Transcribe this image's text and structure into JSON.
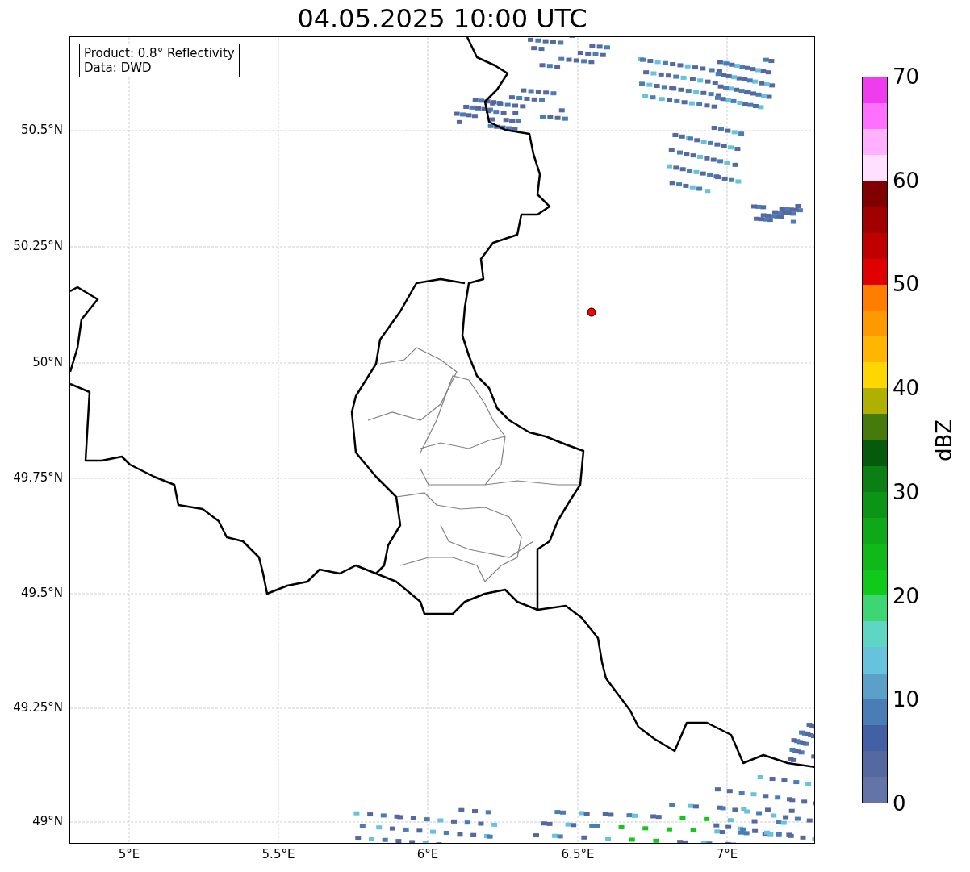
{
  "title": "04.05.2025 10:00 UTC",
  "map": {
    "legend": [
      "Product: 0.8° Reflectivity",
      "Data: DWD"
    ],
    "x_ticks": [
      "5°E",
      "5.5°E",
      "6°E",
      "6.5°E",
      "7°E"
    ],
    "y_ticks": [
      "50.5°N",
      "50.25°N",
      "50°N",
      "49.75°N",
      "49.5°N",
      "49.25°N",
      "49°N"
    ]
  },
  "colorbar": {
    "label": "dBZ",
    "ticks": [
      "70",
      "60",
      "50",
      "40",
      "30",
      "20",
      "10",
      "0"
    ],
    "bins": [
      {
        "color": "#ee3cee"
      },
      {
        "color": "#ff70ff"
      },
      {
        "color": "#ffb0ff"
      },
      {
        "color": "#ffe0ff"
      },
      {
        "color": "#800000"
      },
      {
        "color": "#a00000"
      },
      {
        "color": "#c00000"
      },
      {
        "color": "#e00000"
      },
      {
        "color": "#ff7e00"
      },
      {
        "color": "#ff9900"
      },
      {
        "color": "#ffb600"
      },
      {
        "color": "#ffd700"
      },
      {
        "color": "#b0b000"
      },
      {
        "color": "#467a0c"
      },
      {
        "color": "#065a0c"
      },
      {
        "color": "#0a8014"
      },
      {
        "color": "#0c9416"
      },
      {
        "color": "#0ea818"
      },
      {
        "color": "#10b81a"
      },
      {
        "color": "#11c91b"
      },
      {
        "color": "#3dd672"
      },
      {
        "color": "#5fd6c4"
      },
      {
        "color": "#66c2dd"
      },
      {
        "color": "#5aa0c8"
      },
      {
        "color": "#4a7db5"
      },
      {
        "color": "#4460a4"
      },
      {
        "color": "#5568a0"
      },
      {
        "color": "#6574a8"
      }
    ]
  }
}
